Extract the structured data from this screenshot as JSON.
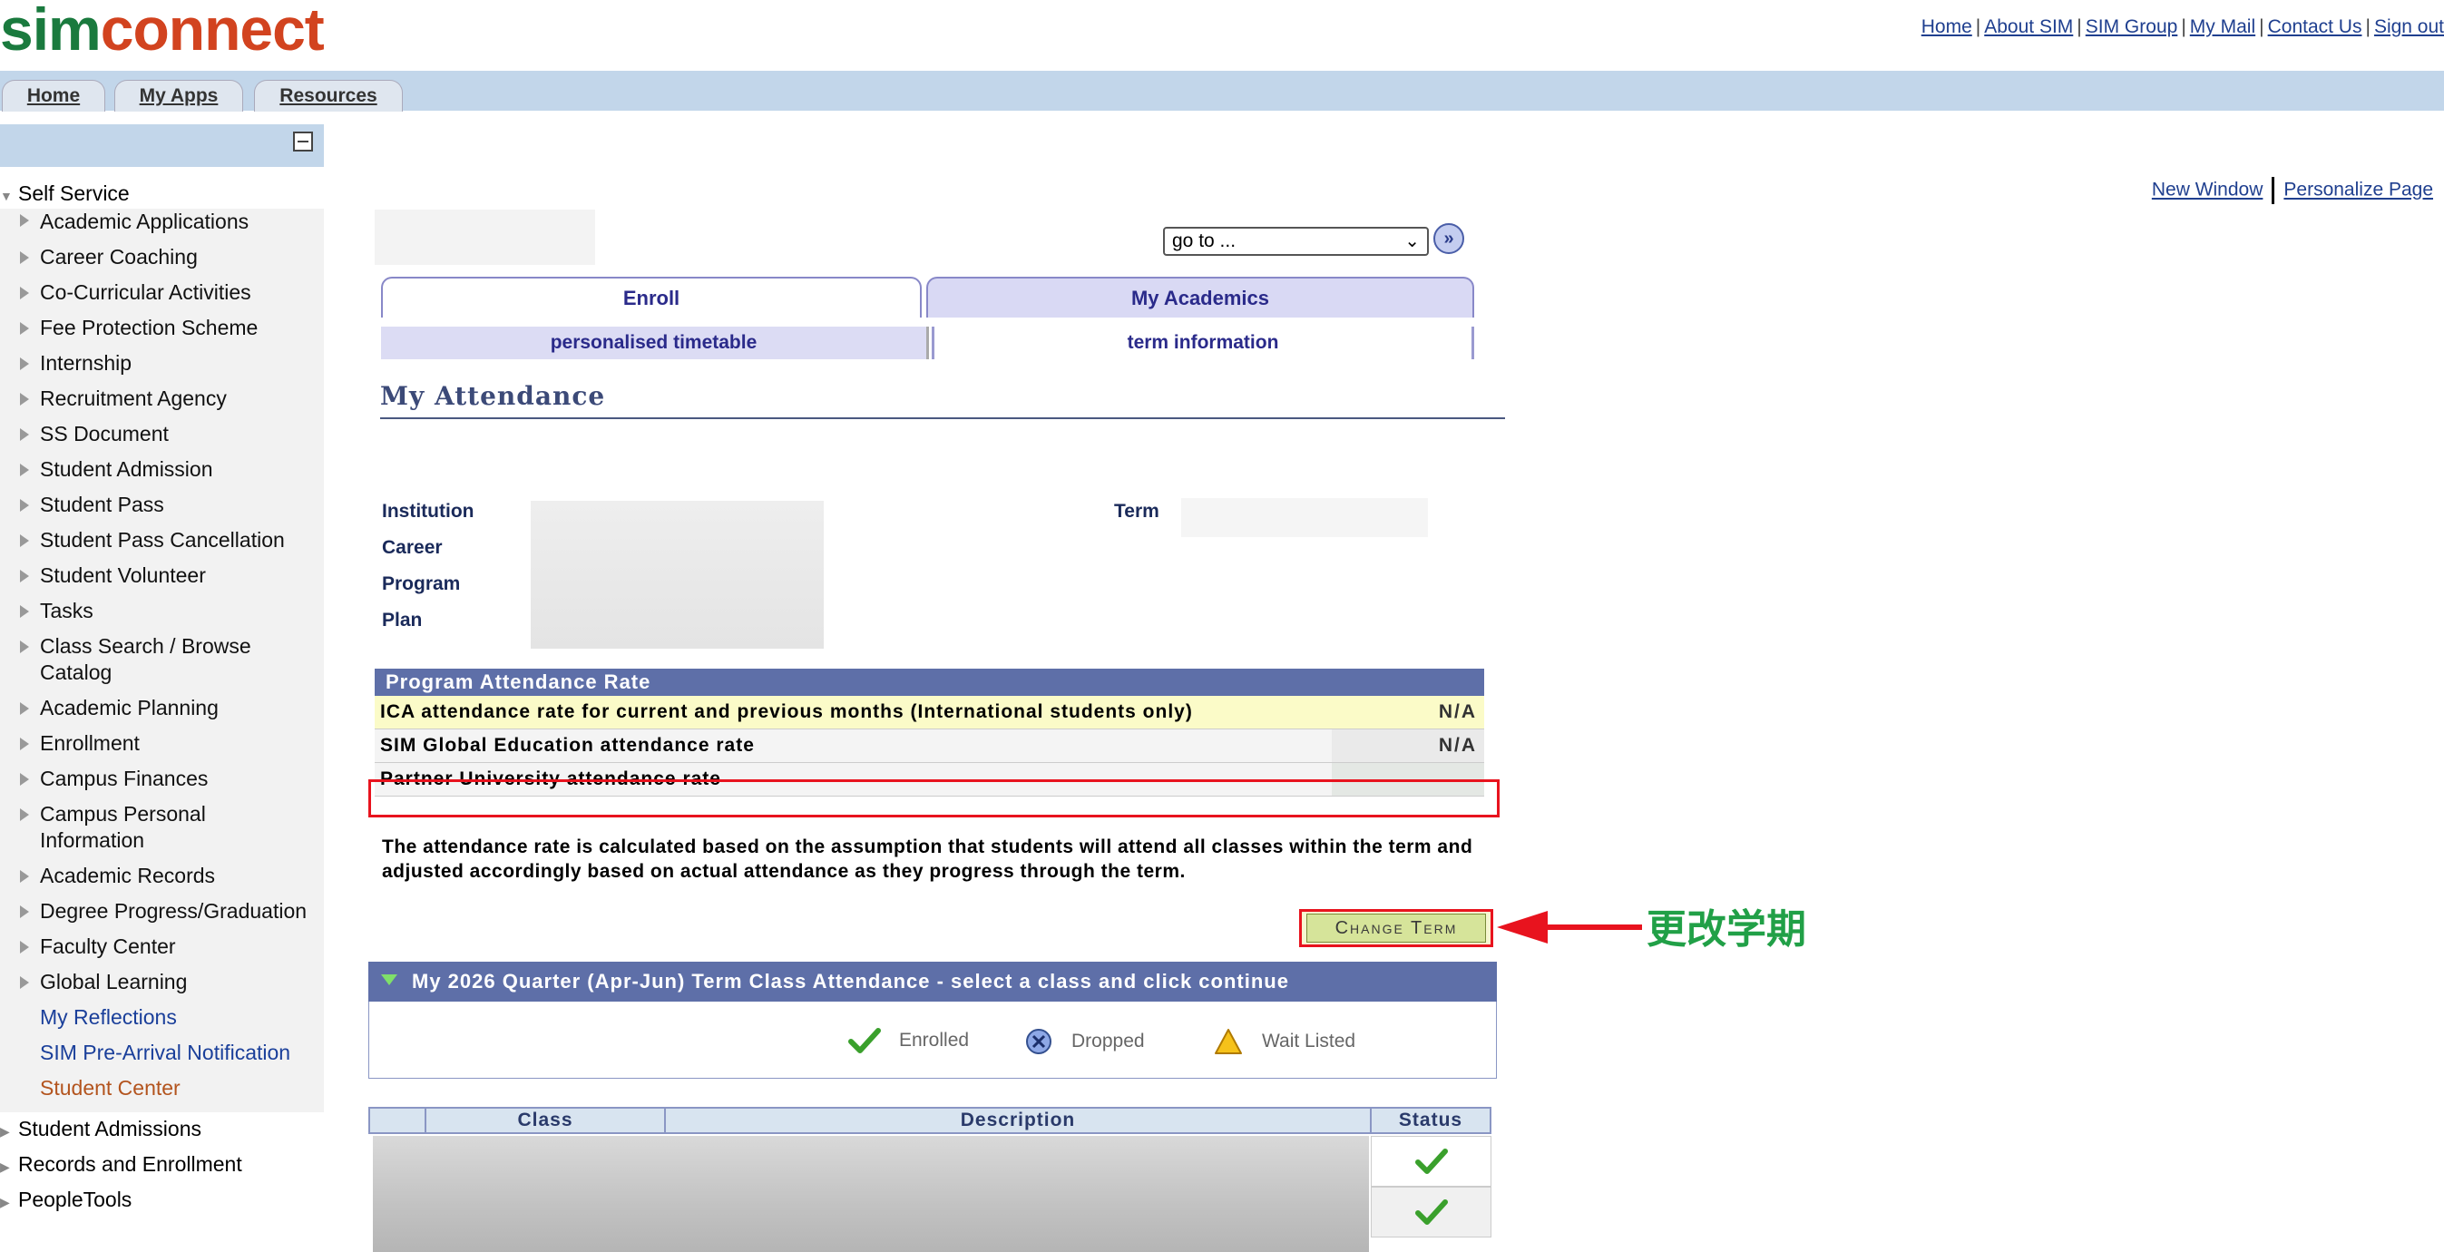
{
  "header": {
    "logo": {
      "part1": "sim",
      "part2": "connect"
    },
    "links": [
      "Home",
      "About SIM",
      "SIM Group",
      "My Mail",
      "Contact Us",
      "Sign out"
    ]
  },
  "nav": {
    "tabs": [
      "Home",
      "My Apps",
      "Resources"
    ]
  },
  "sidebar": {
    "root": "Self Service",
    "items": [
      "Academic Applications",
      "Career Coaching",
      "Co-Curricular Activities",
      "Fee Protection Scheme",
      "Internship",
      "Recruitment Agency",
      "SS Document",
      "Student Admission",
      "Student Pass",
      "Student Pass Cancellation",
      "Student Volunteer",
      "Tasks",
      "Class Search / Browse Catalog",
      "Academic Planning",
      "Enrollment",
      "Campus Finances",
      "Campus Personal Information",
      "Academic Records",
      "Degree Progress/Graduation",
      "Faculty Center",
      "Global Learning"
    ],
    "links": [
      "My Reflections",
      "SIM Pre-Arrival Notification"
    ],
    "current": "Student Center",
    "other_roots": [
      "Student Admissions",
      "Records and Enrollment",
      "PeopleTools"
    ]
  },
  "page_links": {
    "new_window": "New Window",
    "personalize": "Personalize Page"
  },
  "goto": {
    "value": "go to ...",
    "button": "»"
  },
  "tabs": {
    "main": [
      "Enroll",
      "My Academics"
    ],
    "sub": [
      "personalised timetable",
      "term information"
    ]
  },
  "page_title": "My Attendance",
  "fields": {
    "institution": "Institution",
    "career": "Career",
    "program": "Program",
    "plan": "Plan",
    "term": "Term"
  },
  "rate_table": {
    "title": "Program Attendance Rate",
    "rows": [
      {
        "label": "ICA attendance rate for current and previous months (International students only)",
        "value": "N/A"
      },
      {
        "label": "SIM Global Education attendance rate",
        "value": "N/A"
      },
      {
        "label": "Partner University attendance rate",
        "value": ""
      }
    ]
  },
  "note": "The attendance rate is calculated based on the assumption that students will attend all classes within the term and adjusted accordingly based on actual attendance as they progress through the term.",
  "change_term": "Change Term",
  "annotation": "更改学期",
  "class_panel": {
    "title": "My 2026 Quarter (Apr-Jun) Term Class Attendance - select a class and click continue",
    "legend": [
      "Enrolled",
      "Dropped",
      "Wait Listed"
    ]
  },
  "grid": {
    "columns": [
      "Class",
      "Description",
      "Status"
    ]
  },
  "colors": {
    "accent_red": "#e8131e",
    "annotation_green": "#21a047",
    "header_blue": "#5e6fa8"
  }
}
